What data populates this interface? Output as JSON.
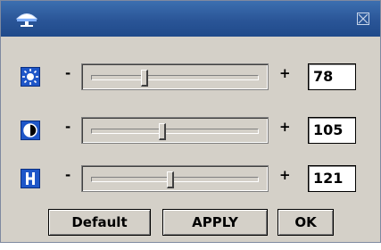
{
  "titlebar": {
    "icon": "display-monitor-icon",
    "close_icon": "close-icon",
    "color": "#2a5597"
  },
  "rows": [
    {
      "icon": "brightness-icon",
      "minus": "-",
      "plus": "+",
      "value": "78",
      "level": 0.31
    },
    {
      "icon": "contrast-icon",
      "minus": "-",
      "plus": "+",
      "value": "105",
      "level": 0.42
    },
    {
      "icon": "hue-icon",
      "minus": "-",
      "plus": "+",
      "value": "121",
      "level": 0.47
    }
  ],
  "buttons": {
    "default_label": "Default",
    "apply_label": "APPLY",
    "ok_label": "OK"
  },
  "colors": {
    "icon_blue": "#1e56c8",
    "panel": "#d4d0c8"
  }
}
